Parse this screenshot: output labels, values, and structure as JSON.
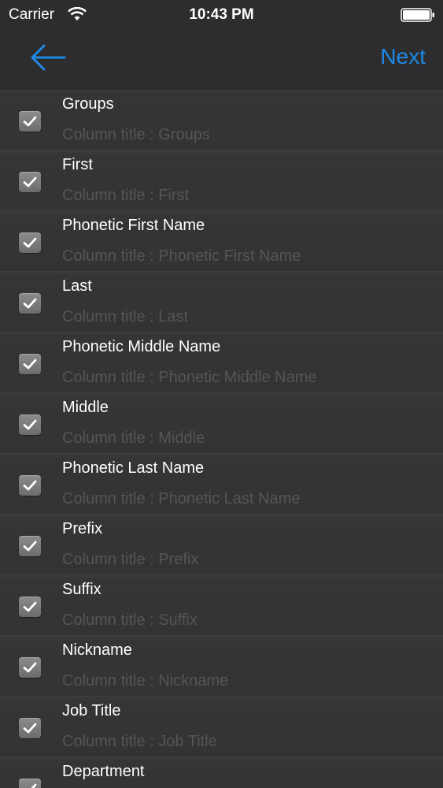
{
  "status_bar": {
    "carrier": "Carrier",
    "time": "10:43 PM",
    "wifi_icon": "wifi-icon",
    "battery_icon": "battery-icon"
  },
  "nav": {
    "back_icon": "back-arrow-icon",
    "next_label": "Next",
    "accent_color": "#1e88e5"
  },
  "rows": [
    {
      "title": "Groups",
      "subtitle": "Column title : Groups",
      "checked": true
    },
    {
      "title": "First",
      "subtitle": "Column title : First",
      "checked": true
    },
    {
      "title": "Phonetic First Name",
      "subtitle": "Column title : Phonetic First Name",
      "checked": true
    },
    {
      "title": "Last",
      "subtitle": "Column title : Last",
      "checked": true
    },
    {
      "title": "Phonetic Middle Name",
      "subtitle": "Column title : Phonetic Middle Name",
      "checked": true
    },
    {
      "title": "Middle",
      "subtitle": "Column title : Middle",
      "checked": true
    },
    {
      "title": "Phonetic Last Name",
      "subtitle": "Column title : Phonetic Last Name",
      "checked": true
    },
    {
      "title": "Prefix",
      "subtitle": "Column title : Prefix",
      "checked": true
    },
    {
      "title": "Suffix",
      "subtitle": "Column title : Suffix",
      "checked": true
    },
    {
      "title": "Nickname",
      "subtitle": "Column title : Nickname",
      "checked": true
    },
    {
      "title": "Job Title",
      "subtitle": "Column title : Job Title",
      "checked": true
    },
    {
      "title": "Department",
      "subtitle": "",
      "checked": true
    }
  ]
}
